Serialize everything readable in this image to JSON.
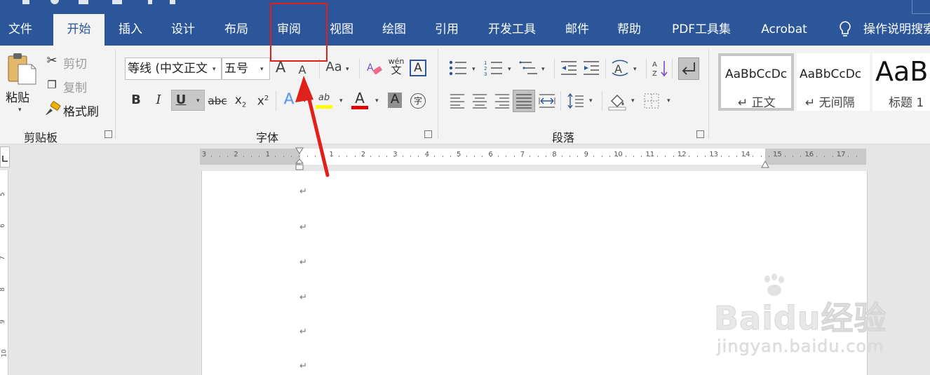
{
  "tabs": [
    {
      "label": "文件",
      "active": false
    },
    {
      "label": "开始",
      "active": true
    },
    {
      "label": "插入",
      "active": false
    },
    {
      "label": "设计",
      "active": false
    },
    {
      "label": "布局",
      "active": false
    },
    {
      "label": "审阅",
      "active": false
    },
    {
      "label": "视图",
      "active": false
    },
    {
      "label": "绘图",
      "active": false
    },
    {
      "label": "引用",
      "active": false
    },
    {
      "label": "开发工具",
      "active": false
    },
    {
      "label": "邮件",
      "active": false
    },
    {
      "label": "帮助",
      "active": false
    },
    {
      "label": "PDF工具集",
      "active": false
    },
    {
      "label": "Acrobat",
      "active": false
    }
  ],
  "tellme": "操作说明搜索",
  "clipboard": {
    "paste": "粘贴",
    "cut": "剪切",
    "copy": "复制",
    "format_painter": "格式刷",
    "group": "剪贴板"
  },
  "font": {
    "name": "等线 (中文正文",
    "size": "五号",
    "group": "字体",
    "change_case": "Aa",
    "phonetic": "wén",
    "phonetic_char": "文"
  },
  "paragraph": {
    "group": "段落"
  },
  "styles": [
    {
      "preview": "AaBbCcDc",
      "name": "↵ 正文",
      "selected": true
    },
    {
      "preview": "AaBbCcDc",
      "name": "↵ 无间隔",
      "selected": false
    },
    {
      "preview": "AaB",
      "name": "标题 1",
      "selected": false
    }
  ],
  "ruler": {
    "left_numbers": [
      "3",
      "2",
      "1"
    ],
    "right_numbers": [
      "1",
      "2",
      "3",
      "4",
      "5",
      "6",
      "7",
      "8",
      "9",
      "10",
      "11",
      "12",
      "13",
      "14",
      "15",
      "16",
      "17"
    ]
  },
  "vruler": {
    "numbers": [
      "5",
      "6",
      "7",
      "8",
      "9",
      "10"
    ]
  },
  "document": {
    "paragraph_marks": [
      "↵",
      "↵",
      "↵",
      "↵",
      "↵",
      "↵"
    ]
  },
  "watermark": {
    "logo": "Baidu经验",
    "url": "jingyan.baidu.com"
  },
  "colors": {
    "accent": "#2b579a",
    "highlight_box": "#e0201a",
    "arrow": "#e0201a",
    "font_color": "#e00000",
    "highlight_color": "#ffff00"
  },
  "icons": [
    "paste-icon",
    "cut-icon",
    "copy-icon",
    "format-painter-icon",
    "bold-icon",
    "italic-icon",
    "underline-icon",
    "strikethrough-icon",
    "subscript-icon",
    "superscript-icon",
    "text-effect-icon",
    "highlight-icon",
    "font-color-icon",
    "char-shading-icon",
    "enclose-char-icon",
    "grow-font-icon",
    "shrink-font-icon",
    "clear-format-icon",
    "char-border-icon",
    "bullets-icon",
    "numbering-icon",
    "multilevel-icon",
    "decrease-indent-icon",
    "increase-indent-icon",
    "chinese-layout-icon",
    "sort-icon",
    "show-marks-icon",
    "align-left-icon",
    "center-icon",
    "align-right-icon",
    "justify-icon",
    "distributed-icon",
    "line-spacing-icon",
    "shading-icon",
    "borders-icon",
    "lightbulb-icon"
  ]
}
